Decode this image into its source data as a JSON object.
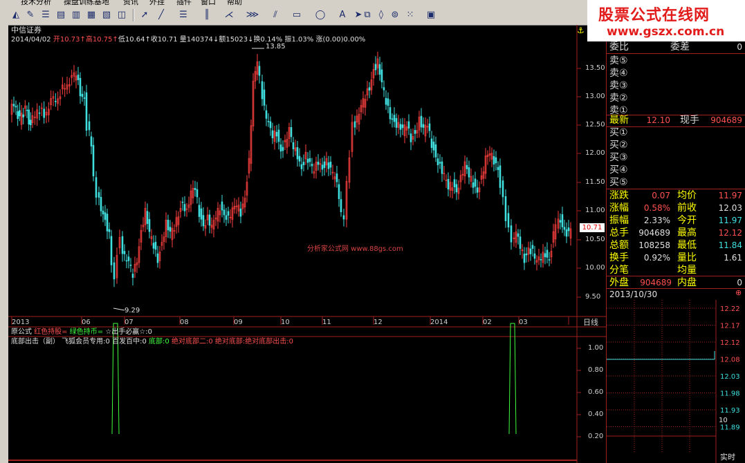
{
  "menu": [
    "技术分析",
    "操盘训练基地",
    "资讯",
    "外挂",
    "插件",
    "窗口",
    "帮助"
  ],
  "toolbar_icons": [
    "chart-icon",
    "wrench-icon",
    "list-icon",
    "grid-icon",
    "window-icon",
    "pointer-icon",
    "line-icon",
    "ray-icon",
    "parallel-icon",
    "fib-icon",
    "gann-icon",
    "rect-icon",
    "circle-icon",
    "text-icon",
    "arrow-icon",
    "copy-icon",
    "eraser-icon",
    "lock-icon",
    "palette-icon",
    "save-icon"
  ],
  "logo": {
    "title": "股票公式在线网",
    "url": "www.gszx.com.cn"
  },
  "stock_name": "中信证券",
  "quote_bar": {
    "date": "2014/04/02",
    "open_label": "开",
    "open": "10.73",
    "high_label": "高",
    "high": "10.75",
    "low_label": "低",
    "low": "10.64",
    "close_label": "收",
    "close": "10.71",
    "volume": "量140374",
    "amount": "额15023",
    "turnover": "换0.14%",
    "amplitude": "振1.03%",
    "change": "涨(0.00)0.00%"
  },
  "price_axis": [
    "13.50",
    "13.00",
    "12.50",
    "12.00",
    "11.50",
    "11.00",
    "10.50",
    "10.00",
    "9.50"
  ],
  "current_price_tag": "10.71",
  "max_label": "13.85",
  "min_label": "9.29",
  "watermark": "分析家公式网 www.88gs.com",
  "time_axis": [
    "2013",
    "06",
    "07",
    "08",
    "09",
    "10",
    "11",
    "12",
    "2014",
    "02",
    "03"
  ],
  "period": "日线",
  "formula_line": {
    "name": "原公式",
    "red": "红色持股=",
    "green": "绿色持币=",
    "star": "☆出手必赢☆:0"
  },
  "indicator_line": {
    "name": "底部出击（副）",
    "items": [
      "飞狐会员专用:0",
      "百发百中:0"
    ],
    "green": "底部:0",
    "reds": [
      "绝对底部二:0",
      "绝对底部:绝对底部出击:0"
    ]
  },
  "indicator_axis": [
    "1.00",
    "0.80",
    "0.60",
    "0.40",
    "0.20"
  ],
  "order_book": {
    "top": {
      "label1": "委比",
      "label2": "委差",
      "value": "0"
    },
    "asks": [
      "卖⑤",
      "卖④",
      "卖③",
      "卖②",
      "卖①"
    ],
    "latest": {
      "label": "最新",
      "price": "12.10",
      "label2": "现手",
      "volume": "904689"
    },
    "bids": [
      "买①",
      "买②",
      "买③",
      "买④",
      "买⑤"
    ]
  },
  "stats": [
    {
      "l1": "涨跌",
      "v1": "0.07",
      "c1": "#ff5050",
      "l2": "均价",
      "v2": "11.97",
      "c2": "#ff5050"
    },
    {
      "l1": "涨幅",
      "v1": "0.58%",
      "c1": "#ff5050",
      "l2": "前收",
      "v2": "12.03",
      "c2": "#e0e0e0"
    },
    {
      "l1": "振幅",
      "v1": "2.33%",
      "c1": "#e0e0e0",
      "l2": "今开",
      "v2": "11.97",
      "c2": "#40e0e0"
    },
    {
      "l1": "总手",
      "v1": "904689",
      "c1": "#e0e0e0",
      "l2": "最高",
      "v2": "12.12",
      "c2": "#ff5050"
    },
    {
      "l1": "总额",
      "v1": "108258",
      "c1": "#e0e0e0",
      "l2": "最低",
      "v2": "11.84",
      "c2": "#40e0e0"
    },
    {
      "l1": "换手",
      "v1": "0.92%",
      "c1": "#e0e0e0",
      "l2": "量比",
      "v2": "1.61",
      "c2": "#e0e0e0"
    },
    {
      "l1": "分笔",
      "v1": "",
      "c1": "#e0e0e0",
      "l2": "均量",
      "v2": "",
      "c2": "#e0e0e0"
    }
  ],
  "outer_inner": {
    "l1": "外盘",
    "v1": "904689",
    "l2": "内盘",
    "v2": "0"
  },
  "mini_chart": {
    "date": "2013/10/30",
    "axis": [
      "12.22",
      "12.17",
      "12.12",
      "12.08",
      "12.03",
      "11.98",
      "11.93",
      "11.89"
    ],
    "vol_label": "10",
    "mode": "实时"
  },
  "colors": {
    "up": "#ff4040",
    "down": "#40e0e0",
    "frame": "#a02020",
    "signal": "#40ff40"
  }
}
